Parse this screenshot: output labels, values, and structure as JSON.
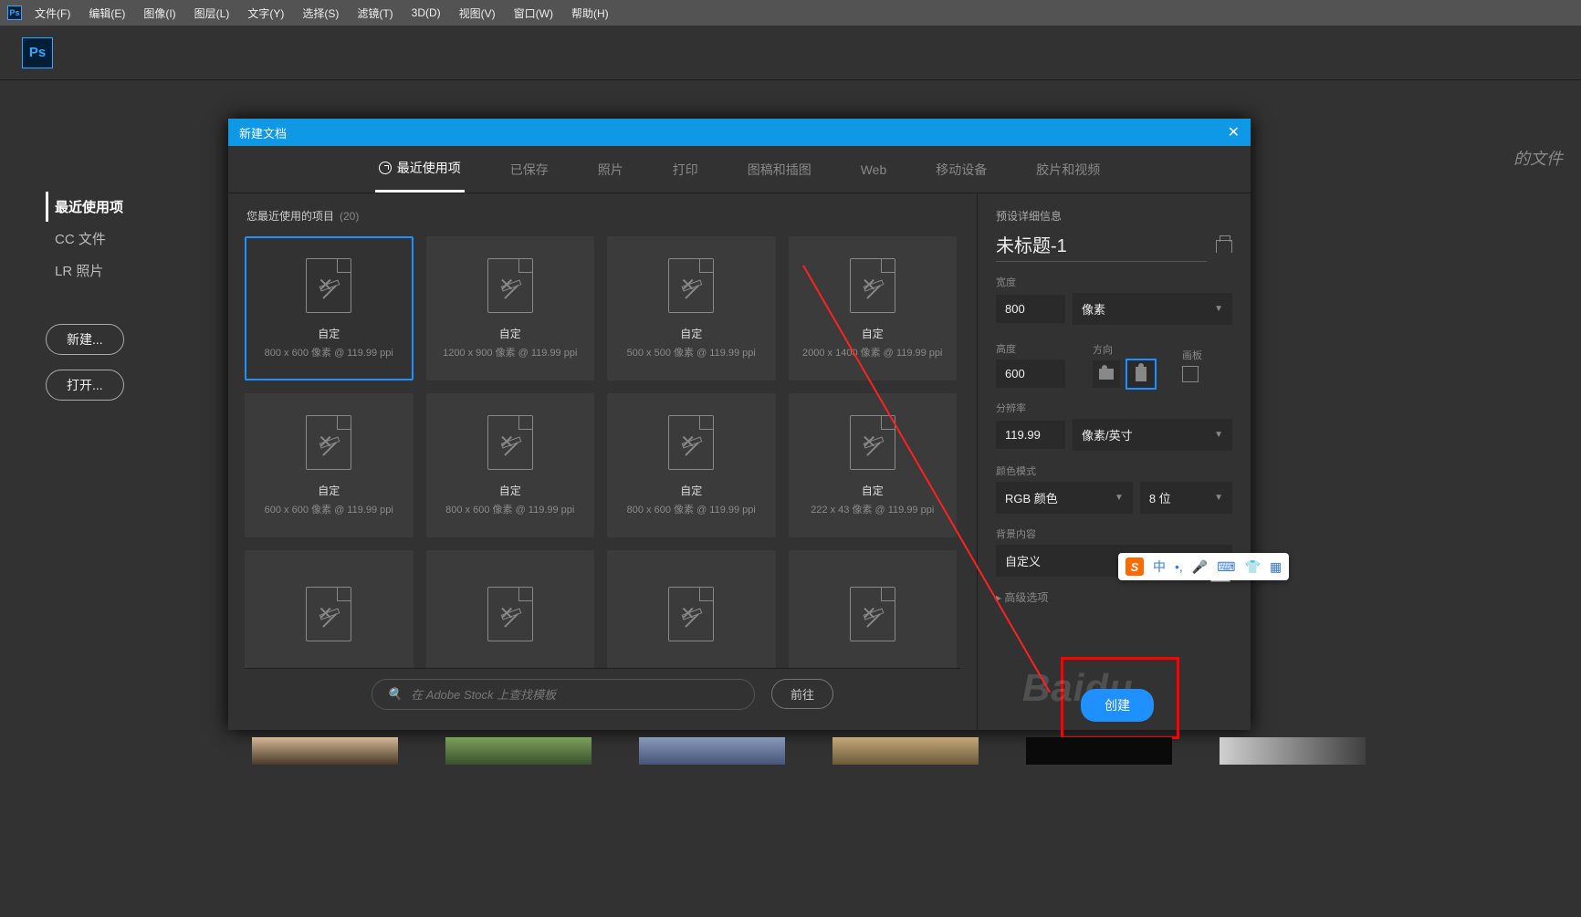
{
  "menubar": {
    "items": [
      "文件(F)",
      "编辑(E)",
      "图像(I)",
      "图层(L)",
      "文字(Y)",
      "选择(S)",
      "滤镜(T)",
      "3D(D)",
      "视图(V)",
      "窗口(W)",
      "帮助(H)"
    ]
  },
  "start": {
    "nav": [
      "最近使用项",
      "CC 文件",
      "LR 照片"
    ],
    "new_btn": "新建...",
    "open_btn": "打开...",
    "bg_hint": "的文件"
  },
  "modal": {
    "title": "新建文档",
    "tabs": [
      "最近使用项",
      "已保存",
      "照片",
      "打印",
      "图稿和插图",
      "Web",
      "移动设备",
      "胶片和视频"
    ],
    "recent_caption": "您最近使用的项目",
    "recent_count": "(20)",
    "presets": [
      {
        "label": "自定",
        "dim": "800 x 600 像素 @ 119.99 ppi",
        "selected": true
      },
      {
        "label": "自定",
        "dim": "1200 x 900 像素 @ 119.99 ppi"
      },
      {
        "label": "自定",
        "dim": "500 x 500 像素 @ 119.99 ppi"
      },
      {
        "label": "自定",
        "dim": "2000 x 1400 像素 @ 119.99 ppi"
      },
      {
        "label": "自定",
        "dim": "600 x 600 像素 @ 119.99 ppi"
      },
      {
        "label": "自定",
        "dim": "800 x 600 像素 @ 119.99 ppi"
      },
      {
        "label": "自定",
        "dim": "800 x 600 像素 @ 119.99 ppi"
      },
      {
        "label": "自定",
        "dim": "222 x 43 像素 @ 119.99 ppi"
      },
      {
        "label": "",
        "dim": ""
      },
      {
        "label": "",
        "dim": ""
      },
      {
        "label": "",
        "dim": ""
      },
      {
        "label": "",
        "dim": ""
      }
    ],
    "stock_placeholder": "在 Adobe Stock 上查找模板",
    "stock_go": "前往"
  },
  "detail": {
    "header": "预设详细信息",
    "name": "未标题-1",
    "width_label": "宽度",
    "width": "800",
    "width_unit": "像素",
    "height_label": "高度",
    "height": "600",
    "orient_label": "方向",
    "artboard_label": "画板",
    "res_label": "分辨率",
    "res": "119.99",
    "res_unit": "像素/英寸",
    "color_label": "颜色模式",
    "color_mode": "RGB 颜色",
    "color_depth": "8 位",
    "bg_label": "背景内容",
    "bg": "自定义",
    "advanced": "高级选项"
  },
  "create_btn": "创建",
  "ime": {
    "lang": "中",
    "sep": "'"
  }
}
